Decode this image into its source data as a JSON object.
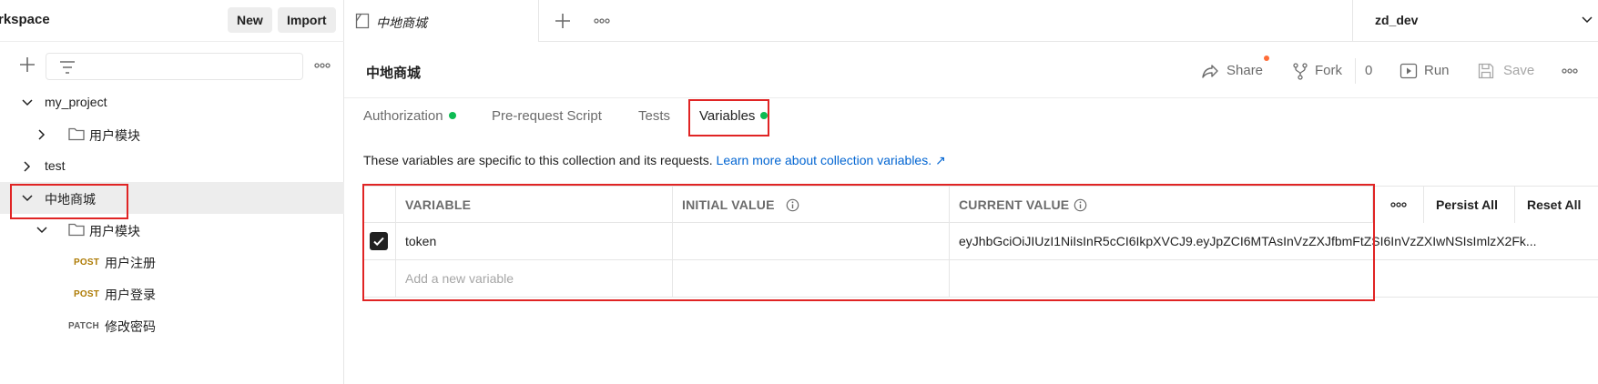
{
  "workspace": {
    "title": "rkspace",
    "new_label": "New",
    "import_label": "Import"
  },
  "sidebar": {
    "items": [
      {
        "label": "my_project",
        "expanded": true
      },
      {
        "label": "用户模块",
        "type": "folder"
      },
      {
        "label": "test",
        "expanded": false
      },
      {
        "label": "中地商城",
        "expanded": true,
        "selected": true
      },
      {
        "label": "用户模块",
        "type": "folder",
        "expanded": true
      },
      {
        "method": "POST",
        "label": "用户注册"
      },
      {
        "method": "POST",
        "label": "用户登录"
      },
      {
        "method": "PATCH",
        "label": "修改密码"
      }
    ]
  },
  "tabs": {
    "active_label": "中地商城",
    "environment": "zd_dev"
  },
  "collection": {
    "title": "中地商城",
    "share_label": "Share",
    "fork_label": "Fork",
    "fork_count": "0",
    "run_label": "Run",
    "save_label": "Save"
  },
  "subtabs": [
    {
      "label": "Authorization",
      "dot": true
    },
    {
      "label": "Pre-request Script",
      "dot": false
    },
    {
      "label": "Tests",
      "dot": false
    },
    {
      "label": "Variables",
      "dot": true,
      "active": true
    }
  ],
  "variables": {
    "description": "These variables are specific to this collection and its requests.",
    "learn_more": "Learn more about collection variables. ↗",
    "columns": [
      "VARIABLE",
      "INITIAL VALUE",
      "CURRENT VALUE"
    ],
    "persist_all": "Persist All",
    "reset_all": "Reset All",
    "rows": [
      {
        "checked": true,
        "variable": "token",
        "initial_value": "",
        "current_value": "eyJhbGciOiJIUzI1NiIsInR5cCI6IkpXVCJ9.eyJpZCI6MTAsInVzZXJfbmFtZSI6InVzZXIwNSIsImlzX2Fk..."
      }
    ],
    "add_placeholder": "Add a new variable"
  },
  "colors": {
    "accent_orange": "#ff6c37",
    "status_green": "#0cbb52",
    "link_blue": "#0265d2",
    "highlight_red": "#e02424"
  }
}
